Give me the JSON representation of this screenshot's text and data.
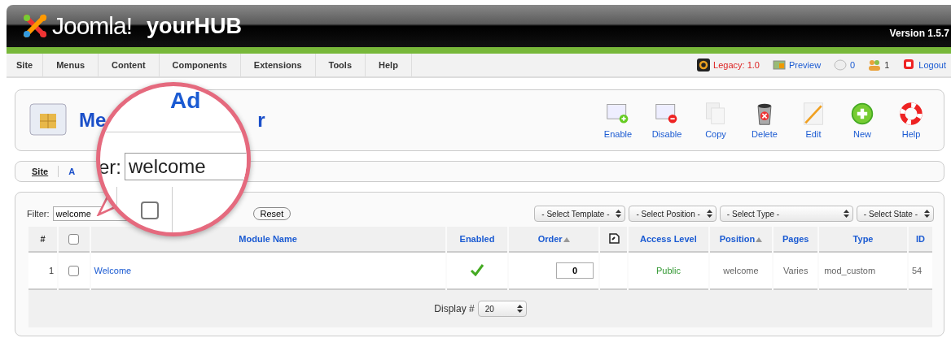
{
  "header": {
    "logo_text": "Joomla!",
    "site_name": "yourHUB",
    "version": "Version 1.5.7"
  },
  "menu": [
    {
      "label": "Site"
    },
    {
      "label": "Menus"
    },
    {
      "label": "Content"
    },
    {
      "label": "Components"
    },
    {
      "label": "Extensions"
    },
    {
      "label": "Tools"
    },
    {
      "label": "Help"
    }
  ],
  "status_links": [
    {
      "kind": "legacy",
      "label": "Legacy: 1.0"
    },
    {
      "kind": "preview",
      "label": "Preview"
    },
    {
      "kind": "messages",
      "label": "0"
    },
    {
      "kind": "users",
      "label": "1"
    },
    {
      "kind": "logout",
      "label": "Logout"
    }
  ],
  "page_title": {
    "start": "Me",
    "end": "r"
  },
  "toolbar": [
    {
      "kind": "enable",
      "label": "Enable"
    },
    {
      "kind": "disable",
      "label": "Disable"
    },
    {
      "kind": "copy",
      "label": "Copy"
    },
    {
      "kind": "delete",
      "label": "Delete"
    },
    {
      "kind": "edit",
      "label": "Edit"
    },
    {
      "kind": "new",
      "label": "New"
    },
    {
      "kind": "help",
      "label": "Help"
    }
  ],
  "subtabs": [
    {
      "label": "Site",
      "selected": true
    },
    {
      "label": "A",
      "selected": false
    }
  ],
  "filter": {
    "label": "Filter:",
    "value": "welcome",
    "reset": "Reset"
  },
  "selects": [
    "- Select Template -",
    "- Select Position -",
    "- Select Type -",
    "- Select State -"
  ],
  "table": {
    "columns": [
      {
        "kind": "plain",
        "label": "#"
      },
      {
        "kind": "checkbox",
        "checked": false
      },
      {
        "kind": "link",
        "label": "Module Name"
      },
      {
        "kind": "link",
        "label": "Enabled"
      },
      {
        "kind": "sorted",
        "label": "Order"
      },
      {
        "kind": "save-icon"
      },
      {
        "kind": "link",
        "label": "Access Level"
      },
      {
        "kind": "sorted",
        "label": "Position"
      },
      {
        "kind": "link",
        "label": "Pages"
      },
      {
        "kind": "link",
        "label": "Type"
      },
      {
        "kind": "link",
        "label": "ID"
      }
    ],
    "rows": [
      {
        "num": "1",
        "checked": false,
        "name": "Welcome",
        "enabled": true,
        "order": "0",
        "access": "Public",
        "position": "welcome",
        "pages": "Varies",
        "type": "mod_custom",
        "id": "54"
      }
    ]
  },
  "pagination": {
    "label": "Display #",
    "value": "20"
  },
  "magnifier": {
    "heading": "Ad",
    "label": "er:",
    "value": "welcome",
    "checked": false
  }
}
